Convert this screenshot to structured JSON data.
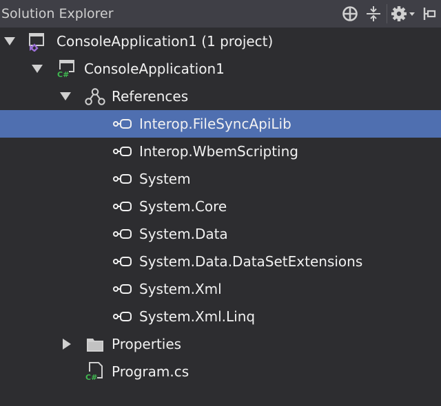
{
  "panel": {
    "title": "Solution Explorer",
    "toolbar": [
      {
        "name": "sync-with-document-icon"
      },
      {
        "name": "collapse-all-icon"
      },
      {
        "name": "properties-gear-icon"
      },
      {
        "name": "pin-icon"
      }
    ]
  },
  "tree": {
    "solution": "ConsoleApplication1 (1 project)",
    "project": "ConsoleApplication1",
    "references": "References",
    "reference_items": [
      "Interop.FileSyncApiLib",
      "Interop.WbemScripting",
      "System",
      "System.Core",
      "System.Data",
      "System.Data.DataSetExtensions",
      "System.Xml",
      "System.Xml.Linq"
    ],
    "selected_reference": "Interop.FileSyncApiLib",
    "properties": "Properties",
    "program": "Program.cs",
    "program_badge": "C#",
    "project_badge": "C#"
  },
  "colors": {
    "background": "#2d2d30",
    "titlebar": "#3f3f46",
    "selection": "#4f6fb0",
    "text": "#f1f1f1",
    "csharp_green": "#3fb950",
    "vs_purple": "#9b6fd6"
  }
}
